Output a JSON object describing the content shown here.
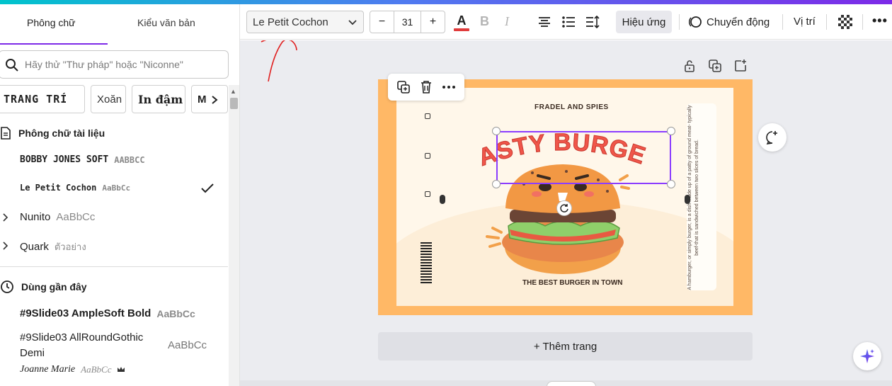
{
  "panel": {
    "tabs": [
      {
        "label": "Phông chữ"
      },
      {
        "label": "Kiểu văn bản"
      }
    ],
    "search": {
      "placeholder": "Hãy thử \"Thư pháp\" hoặc \"Niconne\""
    },
    "chips": [
      {
        "label": "TRANG TRÍ"
      },
      {
        "label": "Xoăn"
      },
      {
        "label": "In đậm"
      },
      {
        "label": "Mô"
      }
    ],
    "document_fonts": {
      "title": "Phông chữ tài liệu",
      "items": [
        {
          "name": "BOBBY JONES SOFT",
          "sample": "AABBCC"
        },
        {
          "name": "Le Petit Cochon",
          "sample": "AaBbCc"
        },
        {
          "name": "Nunito",
          "sample": "AaBbCc"
        },
        {
          "name": "Quark",
          "sample": "ตัวอย่าง"
        }
      ]
    },
    "recent_fonts": {
      "title": "Dùng gần đây",
      "items": [
        {
          "name": "#9Slide03 AmpleSoft Bold",
          "sample": "AaBbCc"
        },
        {
          "name": "#9Slide03 AllRoundGothic Demi",
          "sample": "AaBbCc"
        },
        {
          "name": "Joanne Marie",
          "sample": "AaBbCc"
        }
      ]
    }
  },
  "toolbar": {
    "font_name": "Le Petit Cochon",
    "font_size": "31",
    "minus": "−",
    "plus": "+",
    "color_letter": "A",
    "bold": "B",
    "italic": "I",
    "effects": "Hiệu ứng",
    "animate": "Chuyển động",
    "position": "Vị trí",
    "more": "•••",
    "text_color": "#e03b3b"
  },
  "design": {
    "brand": "FRADEL AND SPIES",
    "title": "TASTY BURGER",
    "tagline": "THE BEST BURGER IN TOWN",
    "side_text": "A hamburger, or simply burger, is a dish made up of a patty of ground meat- typically beef-that is sandwiched between two slices of bread."
  },
  "add_page": "+ Thêm trang",
  "colors": {
    "accent": "#8b3dff",
    "page_orange": "#ffb866",
    "title_red": "#f0564a"
  }
}
